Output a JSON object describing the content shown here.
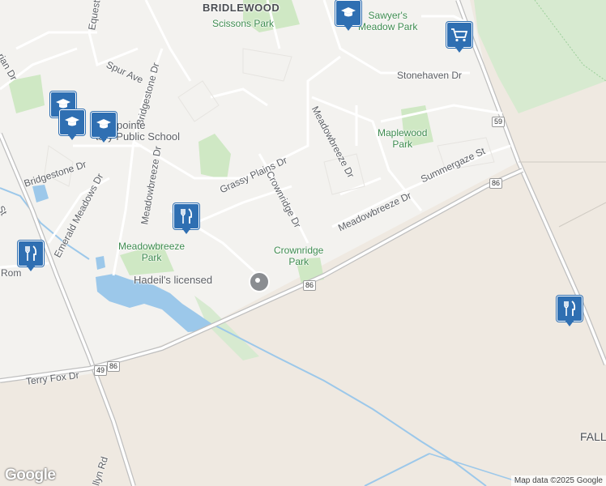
{
  "map": {
    "place_labels": {
      "bridlewood": "BRIDLEWOOD",
      "fall": "FALL"
    },
    "street_labels": {
      "equestrian": "Equestria",
      "equesti": "Equesti",
      "spur_ave": "Spur Ave",
      "bridgestone_dr_v": "Bridgestone Dr",
      "bridgestone_dr_h": "Bridgestone Dr",
      "grassy_plains": "Grassy Plains Dr",
      "crownridge_dr": "Crownridge Dr",
      "meadowbreeze_dr_n": "Meadowbreeze Dr",
      "meadowbreeze_dr_s": "Meadowbreeze Dr",
      "meadowbreeze_dr_w": "Meadowbreeze Dr",
      "summergaze": "Summergaze St",
      "stonehaven": "Stonehaven Dr",
      "emerald_meadows": "Emerald Meadows Dr",
      "terry_fox": "Terry Fox Dr",
      "rom": "Rom",
      "lyn_rd": "llyn Rd",
      "st": "St",
      "rian_dr": "rian Dr"
    },
    "park_labels": {
      "scissons": "Scissons Park",
      "sawyers": "Sawyer's\nMeadow Park",
      "maplewood": "Maplewood\nPark",
      "meadowbreeze": "Meadowbreeze\nPark",
      "crownridge": "Crownridge\nPark"
    },
    "poi": {
      "school_label": "e-Lapointe\ntary Public School",
      "hadeil": "Hadeil's licensed"
    },
    "route_shields": {
      "r59": "59",
      "r86_east": "86",
      "r86_mid": "86",
      "r86_west": "86",
      "r49": "49"
    },
    "icons": {
      "school_icon": "graduation-cap-icon",
      "restaurant_icon": "fork-knife-icon",
      "shopping_icon": "shopping-cart-icon"
    },
    "brand": "Google",
    "attribution": "Map data ©2025 Google",
    "colors": {
      "marker": "#2f6fb2",
      "park": "#cfe8c4",
      "water": "#9cc8ea",
      "road": "#ffffff",
      "land": "#efe9e1"
    }
  }
}
